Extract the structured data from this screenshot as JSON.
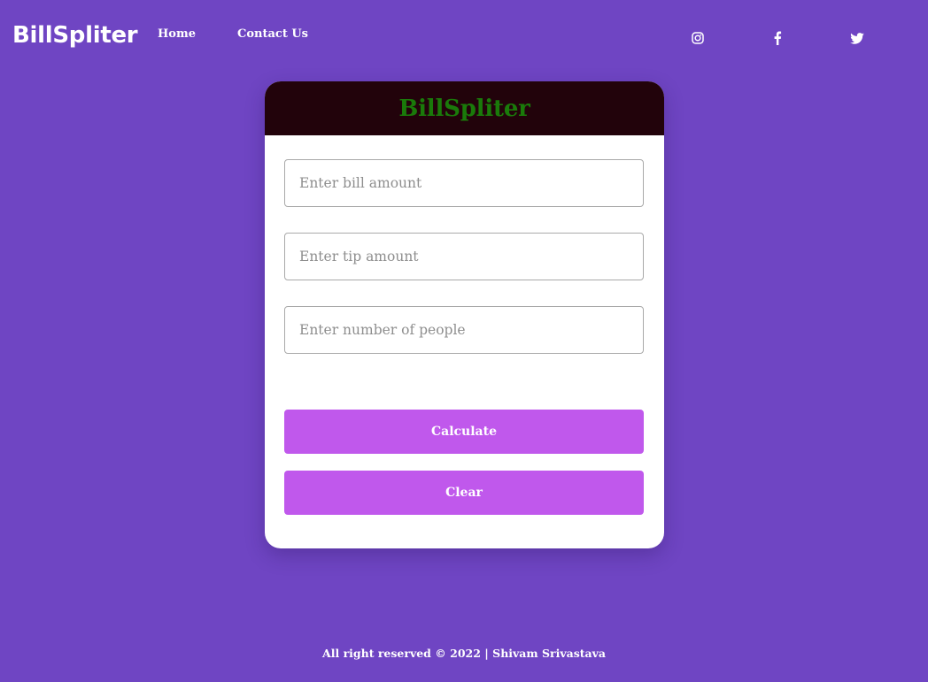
{
  "colors": {
    "page_background": "#6f45c3",
    "card_header_background": "#22030b",
    "card_title": "#1a7a0a",
    "button_background": "#c058ec",
    "text_on_purple": "#ffffff"
  },
  "nav": {
    "brand": "BillSpliter",
    "links": [
      {
        "label": "Home"
      },
      {
        "label": "Contact Us"
      }
    ],
    "social_icons": [
      "instagram-icon",
      "facebook-icon",
      "twitter-icon"
    ]
  },
  "card": {
    "title": "BillSpliter",
    "fields": {
      "bill": {
        "value": "",
        "placeholder": "Enter bill amount"
      },
      "tip": {
        "value": "",
        "placeholder": "Enter tip amount"
      },
      "people": {
        "value": "",
        "placeholder": "Enter number of people"
      }
    },
    "buttons": {
      "calculate": "Calculate",
      "clear": "Clear"
    }
  },
  "footer": {
    "text": "All right reserved © 2022 | Shivam Srivastava"
  }
}
